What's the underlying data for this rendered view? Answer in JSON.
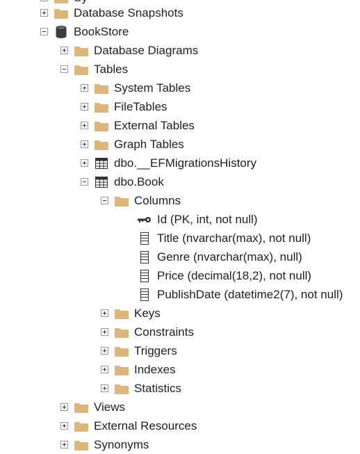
{
  "tree": {
    "top_partial_label": "Sy",
    "database_snapshots": "Database Snapshots",
    "bookstore": "BookStore",
    "database_diagrams": "Database Diagrams",
    "tables": "Tables",
    "system_tables": "System Tables",
    "file_tables": "FileTables",
    "external_tables": "External Tables",
    "graph_tables": "Graph Tables",
    "ef_migrations": "dbo.__EFMigrationsHistory",
    "dbo_book": "dbo.Book",
    "columns": "Columns",
    "column_items": [
      "Id (PK, int, not null)",
      "Title (nvarchar(max), not null)",
      "Genre (nvarchar(max), null)",
      "Price (decimal(18,2), not null)",
      "PublishDate (datetime2(7), not null)"
    ],
    "keys": "Keys",
    "constraints": "Constraints",
    "triggers": "Triggers",
    "indexes": "Indexes",
    "statistics": "Statistics",
    "views": "Views",
    "external_resources": "External Resources",
    "synonyms": "Synonyms"
  },
  "colors": {
    "folder": "#dcb67a",
    "folder_dark": "#c9a063",
    "db": "#3c3c3c",
    "text": "#1e1e1e"
  }
}
